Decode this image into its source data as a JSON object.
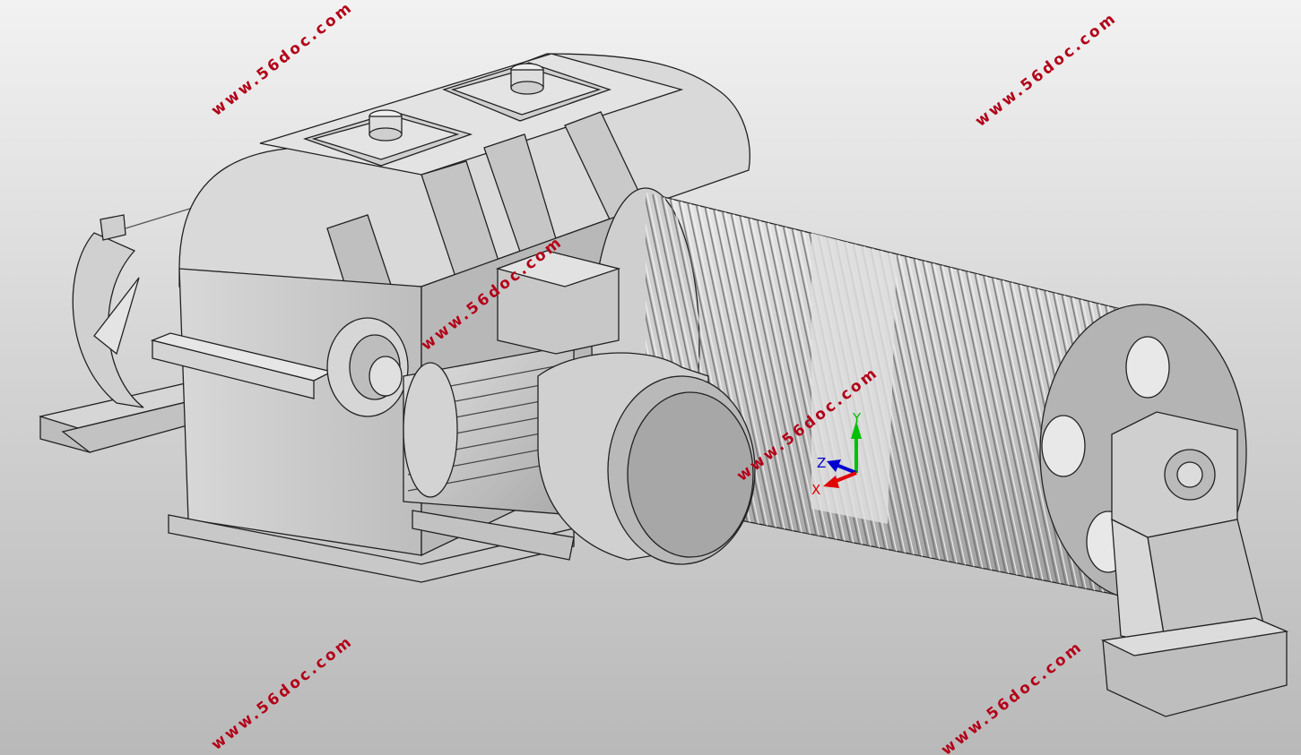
{
  "watermarks": [
    {
      "text": "www.56doc.com"
    },
    {
      "text": "www.56doc.com"
    },
    {
      "text": "www.56doc.com"
    },
    {
      "text": "www.56doc.com"
    },
    {
      "text": "www.56doc.com"
    },
    {
      "text": "www.56doc.com"
    }
  ],
  "triad": {
    "x_label": "X",
    "y_label": "Y",
    "z_label": "Z"
  },
  "colors": {
    "watermark": "#b00018",
    "x_axis": "#e00000",
    "y_axis": "#00c000",
    "z_axis": "#0000d0",
    "model_shade": "#c8c8c8",
    "background_top": "#f2f2f2",
    "background_bottom": "#b9b9b9"
  }
}
